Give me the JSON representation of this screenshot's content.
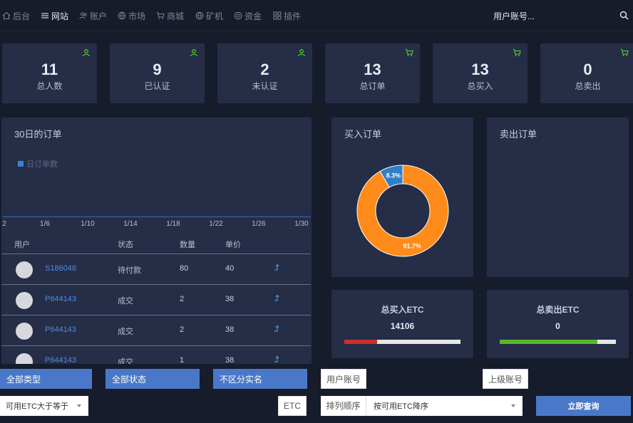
{
  "nav": {
    "items": [
      {
        "label": "后台",
        "icon": "home-icon"
      },
      {
        "label": "网站",
        "icon": "list-icon"
      },
      {
        "label": "账户",
        "icon": "users-icon"
      },
      {
        "label": "市场",
        "icon": "globe-icon"
      },
      {
        "label": "商城",
        "icon": "cart-icon"
      },
      {
        "label": "矿机",
        "icon": "globe-icon"
      },
      {
        "label": "资金",
        "icon": "coin-icon"
      },
      {
        "label": "插件",
        "icon": "grid-icon"
      }
    ],
    "active_index": 1,
    "user_account": "用户账号...",
    "search_icon": "search-icon"
  },
  "stats": [
    {
      "value": "11",
      "label": "总人数",
      "icon": "user-icon"
    },
    {
      "value": "9",
      "label": "已认证",
      "icon": "user-icon"
    },
    {
      "value": "2",
      "label": "未认证",
      "icon": "user-icon"
    },
    {
      "value": "13",
      "label": "总订单",
      "icon": "cart-icon"
    },
    {
      "value": "13",
      "label": "总买入",
      "icon": "cart-icon"
    },
    {
      "value": "0",
      "label": "总卖出",
      "icon": "cart-icon"
    }
  ],
  "colors": {
    "accent_green": "#57c02b",
    "donut_orange": "#ff8c1a",
    "donut_blue": "#2f7fc6",
    "bar_red": "#c9302c",
    "bar_green": "#57b92a"
  },
  "orders_panel": {
    "title": "30日的订单",
    "legend": "日订单数",
    "x_ticks": [
      "2",
      "1/6",
      "1/10",
      "1/14",
      "1/18",
      "1/22",
      "1/26",
      "1/30"
    ]
  },
  "table": {
    "headers": [
      "用户",
      "状态",
      "数量",
      "单价"
    ],
    "rows": [
      {
        "user": "S186048",
        "status": "待付款",
        "qty": "80",
        "price": "40"
      },
      {
        "user": "P644143",
        "status": "成交",
        "qty": "2",
        "price": "38"
      },
      {
        "user": "P644143",
        "status": "成交",
        "qty": "2",
        "price": "38"
      },
      {
        "user": "P644143",
        "status": "成交",
        "qty": "1",
        "price": "38"
      }
    ]
  },
  "buy_panel": {
    "title": "买入订单"
  },
  "sell_panel": {
    "title": "卖出订单"
  },
  "chart_data": {
    "type": "pie",
    "title": "买入订单",
    "slices": [
      {
        "label": "91.7%",
        "value": 91.7,
        "color": "#ff8c1a"
      },
      {
        "label": "8.3%",
        "value": 8.3,
        "color": "#2f7fc6"
      }
    ]
  },
  "total_buy": {
    "title": "总买入ETC",
    "value": "14106",
    "fill_fraction": 0.28
  },
  "total_sell": {
    "title": "总卖出ETC",
    "value": "0",
    "fill_fraction": 0.84
  },
  "filters": {
    "type": "全部类型",
    "status": "全部状态",
    "realname": "不区分实名",
    "user_account": "用户账号",
    "parent_account": "上级账号",
    "etc_select": "可用ETC大于等于",
    "etc_unit": "ETC",
    "sort_label": "排列顺序",
    "sort_select": "按可用ETC降序",
    "submit": "立即查询"
  }
}
